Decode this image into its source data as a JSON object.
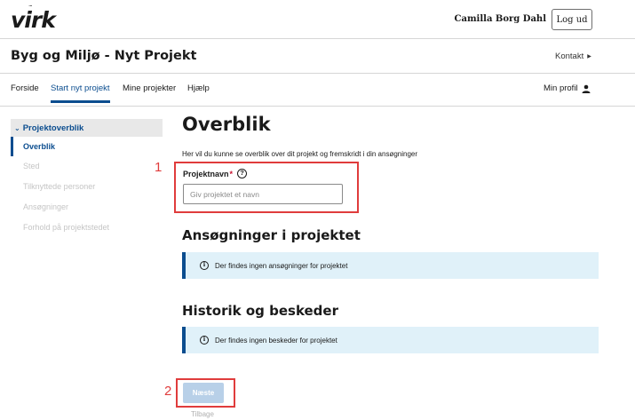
{
  "topbar": {
    "logo_text": "virk",
    "user_name": "Camilla Borg Dahl",
    "logout_label": "Log ud"
  },
  "header": {
    "title": "Byg og Miljø - Nyt Projekt",
    "contact_label": "Kontakt"
  },
  "nav": {
    "items": [
      {
        "label": "Forside"
      },
      {
        "label": "Start nyt projekt",
        "active": true
      },
      {
        "label": "Mine projekter"
      },
      {
        "label": "Hjælp"
      }
    ],
    "profile_label": "Min profil"
  },
  "sidebar": {
    "group_label": "Projektoverblik",
    "items": [
      {
        "label": "Overblik",
        "current": true
      },
      {
        "label": "Sted"
      },
      {
        "label": "Tilknyttede personer"
      },
      {
        "label": "Ansøgninger"
      },
      {
        "label": "Forhold på projektstedet"
      }
    ]
  },
  "main": {
    "title": "Overblik",
    "intro": "Her vil du kunne se overblik over dit projekt og fremskridt i din ansøgninger",
    "project_name": {
      "label": "Projektnavn",
      "required_mark": "*",
      "help_glyph": "?",
      "placeholder": "Giv projektet et navn",
      "value": ""
    },
    "applications": {
      "heading": "Ansøgninger i projektet",
      "info": "Der findes ingen ansøgninger for projektet"
    },
    "history": {
      "heading": "Historik og beskeder",
      "info": "Der findes ingen beskeder for projektet"
    },
    "next_label": "Næste",
    "back_label": "Tilbage"
  },
  "annotations": {
    "marker_1": "1",
    "marker_2": "2",
    "color": "#e03c3c"
  },
  "colors": {
    "primary": "#0b4d8f",
    "info_bg": "#e0f1f9",
    "required": "#c8102e",
    "disabled_button": "#b8d0e8"
  },
  "icons": {
    "chevron_right": "chevron-right-icon",
    "chevron_down": "chevron-down-icon",
    "user": "user-icon",
    "help": "help-circle-icon",
    "info": "info-circle-icon",
    "crown": "crown-icon"
  }
}
